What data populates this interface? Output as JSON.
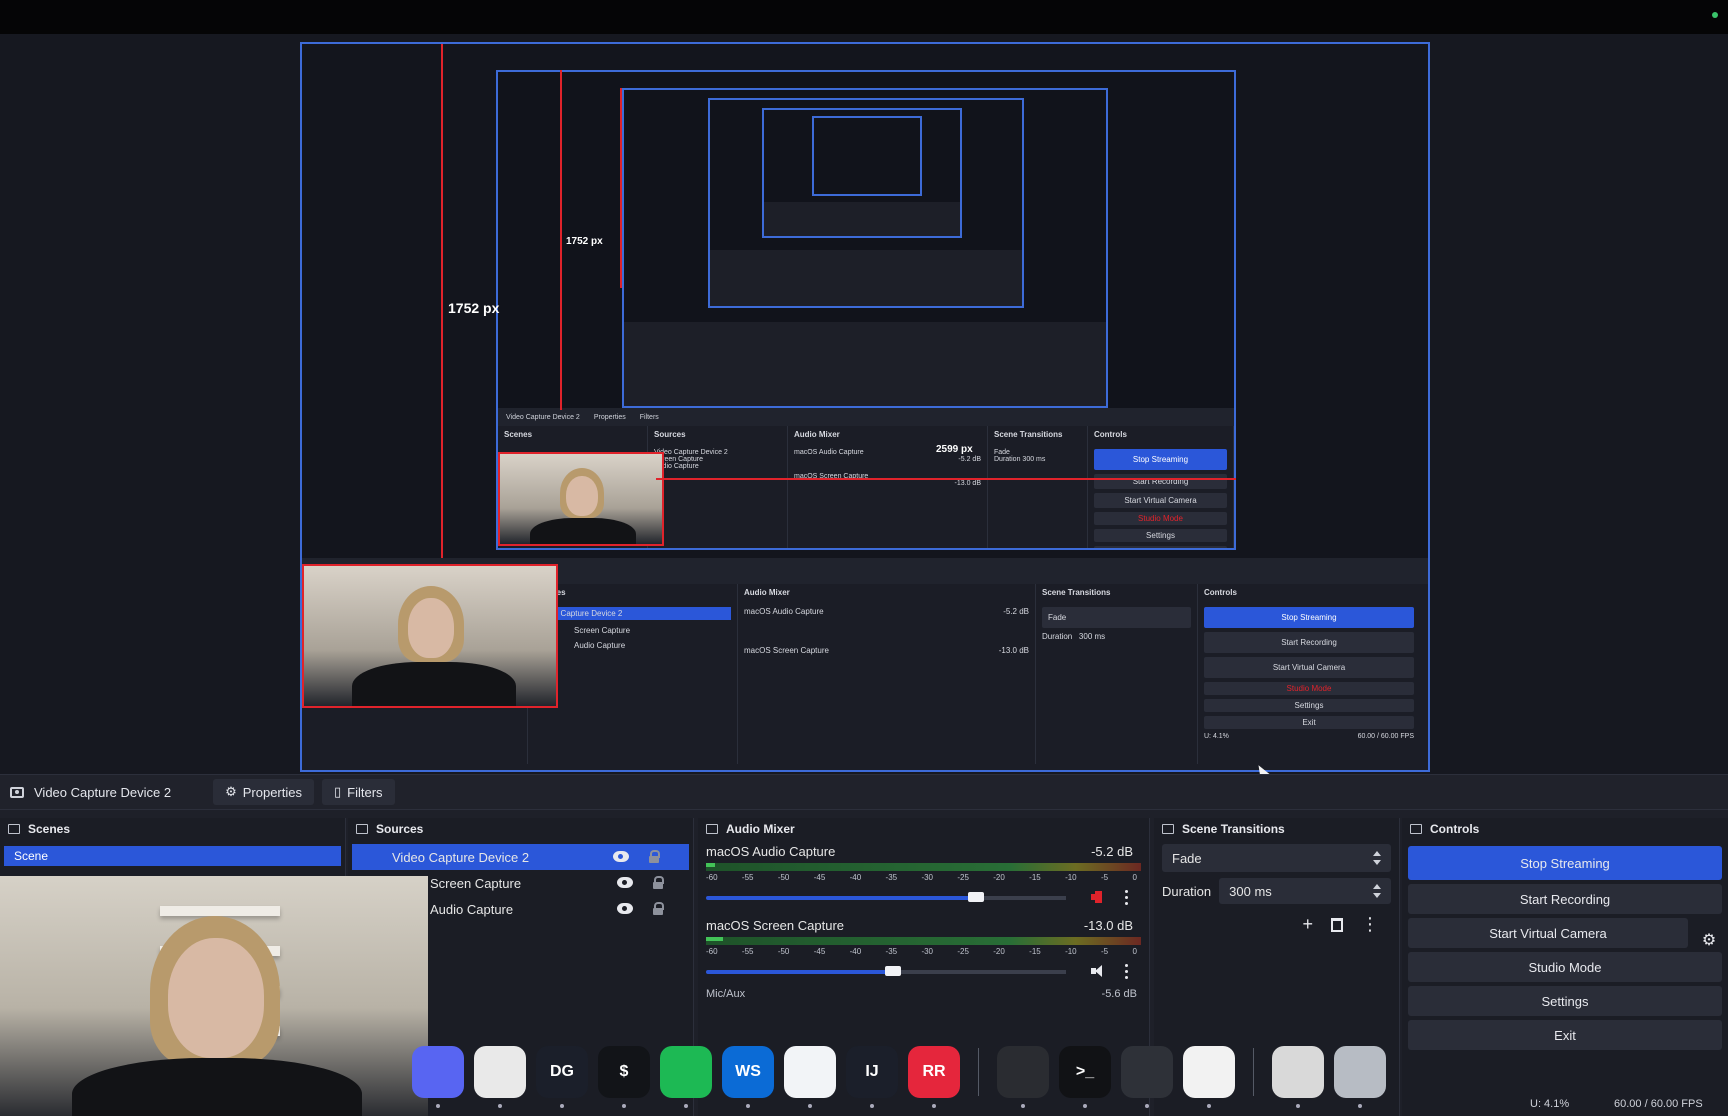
{
  "preview": {
    "measure_v": "1752 px",
    "measure_h": "2599 px",
    "nested": {
      "source_title": "Video Capture Device 2",
      "properties": "Properties",
      "filters": "Filters",
      "scenes": "Scenes",
      "sources": "Sources",
      "audio_mixer": "Audio Mixer",
      "scene_transitions": "Scene Transitions",
      "controls": "Controls",
      "src_1": "Video Capture Device 2",
      "src_2": "Screen Capture",
      "src_3": "Audio Capture",
      "mix_1": "macOS Audio Capture",
      "mix_1_db": "-5.2 dB",
      "mix_2": "macOS Screen Capture",
      "mix_2_db": "-13.0 dB",
      "fade": "Fade",
      "duration": "Duration",
      "duration_val": "300 ms",
      "stop_streaming": "Stop Streaming",
      "start_recording": "Start Recording",
      "start_virtual_camera": "Start Virtual Camera",
      "studio_mode": "Studio Mode",
      "settings": "Settings",
      "exit": "Exit",
      "cpu": "U: 4.1%",
      "fps": "60.00 / 60.00 FPS"
    }
  },
  "toolbar": {
    "source_name": "Video Capture Device 2",
    "properties": "Properties",
    "filters": "Filters"
  },
  "scenes": {
    "title": "Scenes",
    "items": [
      "Scene"
    ]
  },
  "sources": {
    "title": "Sources",
    "items": [
      {
        "label": "Video Capture Device 2",
        "selected": true
      },
      {
        "label": "Screen Capture",
        "selected": false
      },
      {
        "label": "Audio Capture",
        "selected": false
      }
    ]
  },
  "mixer": {
    "title": "Audio Mixer",
    "ticks": [
      "-60",
      "-55",
      "-50",
      "-45",
      "-40",
      "-35",
      "-30",
      "-25",
      "-20",
      "-15",
      "-10",
      "-5",
      "0"
    ],
    "channels": [
      {
        "name": "macOS Audio Capture",
        "db": "-5.2 dB",
        "volume": 0.75,
        "level": 0.02,
        "muted": true
      },
      {
        "name": "macOS Screen Capture",
        "db": "-13.0 dB",
        "volume": 0.52,
        "level": 0.04,
        "muted": false
      }
    ],
    "cut_name": "Mic/Aux",
    "cut_db": "-5.6 dB"
  },
  "transitions": {
    "title": "Scene Transitions",
    "selected": "Fade",
    "duration_label": "Duration",
    "duration_value": "300 ms"
  },
  "controls": {
    "title": "Controls",
    "stop_streaming": "Stop Streaming",
    "start_recording": "Start Recording",
    "start_virtual_camera": "Start Virtual Camera",
    "studio_mode": "Studio Mode",
    "settings": "Settings",
    "exit": "Exit"
  },
  "status": {
    "cpu": "U: 4.1%",
    "fps": "60.00 / 60.00 FPS"
  },
  "dock_apps": [
    {
      "name": "discord-icon",
      "label": "",
      "color": "#5865f2"
    },
    {
      "name": "chrome-icon",
      "label": "",
      "color": "#e9e9e9"
    },
    {
      "name": "datagrip-icon",
      "label": "DG",
      "color": "#1b1f2a"
    },
    {
      "name": "terminal-dollar-icon",
      "label": "$",
      "color": "#121418"
    },
    {
      "name": "spotify-icon",
      "label": "",
      "color": "#1db954"
    },
    {
      "name": "webstorm-icon",
      "label": "WS",
      "color": "#0b6bd6"
    },
    {
      "name": "vscode-icon",
      "label": "",
      "color": "#f2f4f7"
    },
    {
      "name": "intellij-icon",
      "label": "IJ",
      "color": "#1b1f2a"
    },
    {
      "name": "rustrover-icon",
      "label": "RR",
      "color": "#e5263c"
    },
    {
      "name": "chatgpt-icon",
      "label": "",
      "color": "#2a2c31"
    },
    {
      "name": "terminal-icon",
      "label": ">_",
      "color": "#111215"
    },
    {
      "name": "obs-icon",
      "label": "",
      "color": "#2e3138"
    },
    {
      "name": "instruments-icon",
      "label": "",
      "color": "#f2f2f2"
    },
    {
      "name": "document-icon",
      "label": "",
      "color": "#d9d9d9"
    },
    {
      "name": "trash-icon",
      "label": "",
      "color": "#b7bcc4"
    }
  ]
}
